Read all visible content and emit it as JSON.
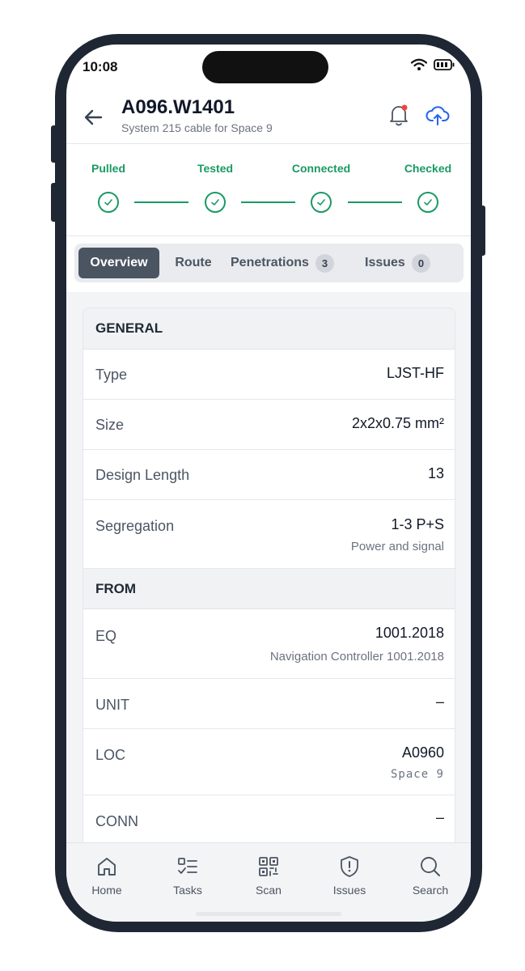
{
  "status_bar": {
    "time": "10:08"
  },
  "header": {
    "title": "A096.W1401",
    "subtitle": "System 215 cable for Space 9"
  },
  "progress": {
    "steps": [
      {
        "label": "Pulled",
        "done": true
      },
      {
        "label": "Tested",
        "done": true
      },
      {
        "label": "Connected",
        "done": true
      },
      {
        "label": "Checked",
        "done": true
      }
    ],
    "color": "#1a9a63"
  },
  "tabs": [
    {
      "label": "Overview",
      "active": true
    },
    {
      "label": "Route"
    },
    {
      "label": "Penetrations",
      "count": "3"
    },
    {
      "label": "Issues",
      "count": "0"
    }
  ],
  "general": {
    "heading": "GENERAL",
    "rows": [
      {
        "label": "Type",
        "value": "LJST-HF"
      },
      {
        "label": "Size",
        "value": "2x2x0.75 mm²"
      },
      {
        "label": "Design Length",
        "value": "13"
      },
      {
        "label": "Segregation",
        "value": "1-3 P+S",
        "sub": "Power and signal"
      }
    ]
  },
  "from": {
    "heading": "FROM",
    "rows": [
      {
        "label": "EQ",
        "value": "1001.2018",
        "sub": "Navigation Controller 1001.2018"
      },
      {
        "label": "UNIT",
        "value": "–"
      },
      {
        "label": "LOC",
        "value": "A0960",
        "sub": "Space 9"
      },
      {
        "label": "CONN",
        "value": "–"
      }
    ]
  },
  "bottom_nav": [
    {
      "label": "Home",
      "icon": "home-icon"
    },
    {
      "label": "Tasks",
      "icon": "tasks-icon"
    },
    {
      "label": "Scan",
      "icon": "qr-scan-icon"
    },
    {
      "label": "Issues",
      "icon": "shield-alert-icon"
    },
    {
      "label": "Search",
      "icon": "search-icon"
    }
  ],
  "colors": {
    "accent_green": "#1a9a63",
    "notification_dot": "#ef4444",
    "upload_blue": "#2563eb"
  }
}
